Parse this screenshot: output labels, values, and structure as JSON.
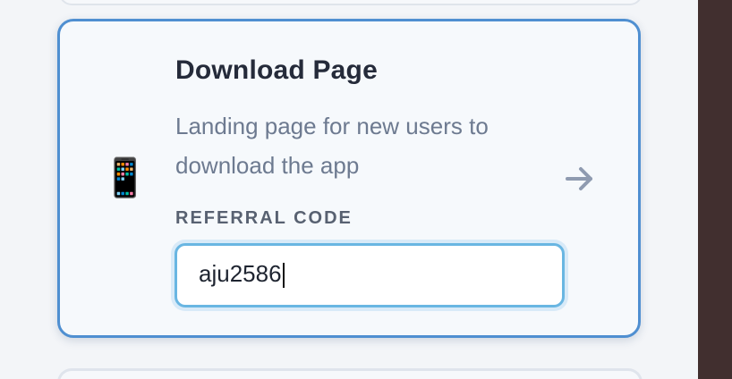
{
  "card": {
    "title": "Download Page",
    "description": "Landing page for new users to download the app",
    "icon": "📱",
    "arrow_icon": "arrow-right-icon"
  },
  "referral": {
    "label": "REFERRAL CODE",
    "value": "aju2586"
  },
  "colors": {
    "card_border": "#4f8fd1",
    "input_border": "#69b6e2",
    "side_panel": "#412f2f"
  }
}
